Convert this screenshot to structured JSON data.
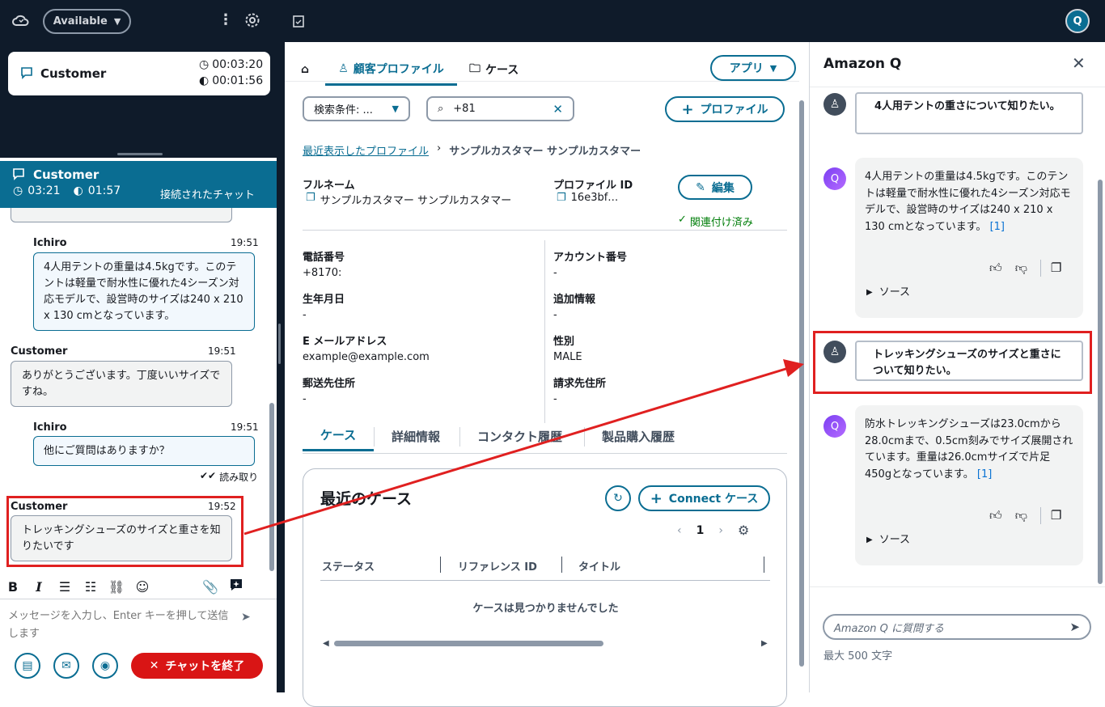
{
  "left": {
    "agent_status": "Available",
    "contact_card": {
      "name": "Customer",
      "time1": "00:03:20",
      "time2": "00:01:56"
    },
    "chat_header": {
      "name": "Customer",
      "time1": "03:21",
      "time2": "01:57",
      "status": "接続されたチャット"
    },
    "messages": [
      {
        "sender": "Ichiro",
        "time": "19:51",
        "text": "4人用テントの重量は4.5kgです。このテントは軽量で耐水性に優れた4シーズン対応モデルで、設営時のサイズは240 x 210 x 130 cmとなっています。",
        "role": "agent"
      },
      {
        "sender": "Customer",
        "time": "19:51",
        "text": "ありがとうございます。丁度いいサイズですね。",
        "role": "customer"
      },
      {
        "sender": "Ichiro",
        "time": "19:51",
        "text": "他にご質問はありますか？",
        "role": "agent",
        "receipt": "読み取り"
      },
      {
        "sender": "Customer",
        "time": "19:52",
        "text": "トレッキングシューズのサイズと重さを知りたいです",
        "role": "customer"
      }
    ],
    "compose_placeholder": "メッセージを入力し、Enter キーを押して送信します",
    "end_chat_label": "チャットを終了"
  },
  "mid": {
    "tabs": [
      "顧客プロファイル",
      "ケース"
    ],
    "app_button": "アプリ",
    "search_filter": "検索条件: ...",
    "search_value": "+81",
    "add_profile": "プロファイル",
    "breadcrumb": {
      "link": "最近表示したプロファイル",
      "current": "サンプルカスタマー サンプルカスタマー"
    },
    "fullname_label": "フルネーム",
    "fullname_value": "サンプルカスタマー サンプルカスタマー",
    "profile_id_label": "プロファイル ID",
    "profile_id_value": "16e3bf…",
    "edit_label": "編集",
    "associated_label": "関連付け済み",
    "fields": [
      {
        "label": "電話番号",
        "value": "+8170:"
      },
      {
        "label": "アカウント番号",
        "value": "-"
      },
      {
        "label": "生年月日",
        "value": "-"
      },
      {
        "label": "追加情報",
        "value": "-"
      },
      {
        "label": "E メールアドレス",
        "value": "example@example.com"
      },
      {
        "label": "性別",
        "value": "MALE"
      },
      {
        "label": "郵送先住所",
        "value": "-"
      },
      {
        "label": "請求先住所",
        "value": "-"
      }
    ],
    "subtabs": [
      "ケース",
      "詳細情報",
      "コンタクト履歴",
      "製品購入履歴"
    ],
    "cases": {
      "title": "最近のケース",
      "connect_button": "Connect ケース",
      "page": "1",
      "columns": [
        "ステータス",
        "リファレンス ID",
        "タイトル"
      ],
      "empty": "ケースは見つかりませんでした"
    }
  },
  "q": {
    "title": "Amazon Q",
    "conversation": [
      {
        "role": "user",
        "text": "4人用テントの重さについて知りたい。"
      },
      {
        "role": "q",
        "text": "4人用テントの重量は4.5kgです。このテントは軽量で耐水性に優れた4シーズン対応モデルで、設営時のサイズは240 x 210 x 130 cmとなっています。",
        "cite": "[1]",
        "sources": "ソース"
      },
      {
        "role": "user",
        "text": "トレッキングシューズのサイズと重さについて知りたい。"
      },
      {
        "role": "q",
        "text": "防水トレッキングシューズは23.0cmから28.0cmまで、0.5cm刻みでサイズ展開されています。重量は26.0cmサイズで片足450gとなっています。",
        "cite": "[1]",
        "sources": "ソース"
      }
    ],
    "input_placeholder": "Amazon Q に質問する",
    "char_limit": "最大 500 文字"
  },
  "colors": {
    "accent": "#0a6d92",
    "dark": "#0f1b2a",
    "highlight": "#e02020",
    "danger": "#d91515"
  }
}
